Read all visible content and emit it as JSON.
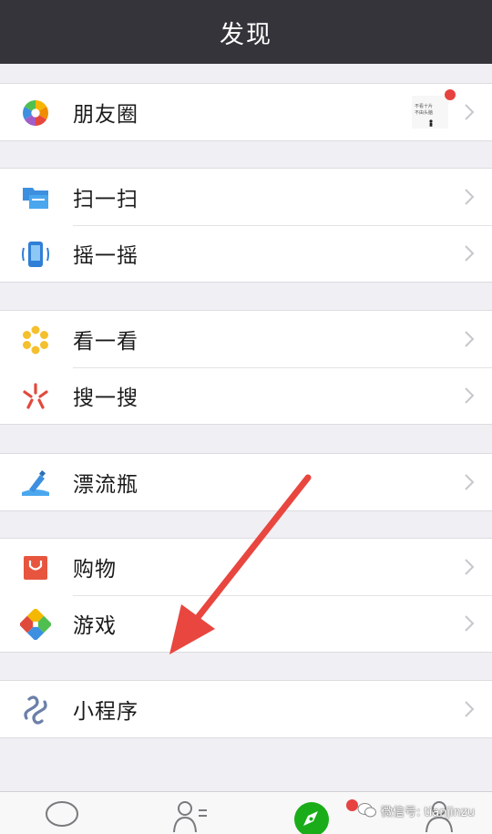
{
  "navbar": {
    "title": "发现"
  },
  "groups": [
    [
      {
        "label": "朋友圈",
        "icon": "moments-icon"
      }
    ],
    [
      {
        "label": "扫一扫",
        "icon": "scan-icon"
      },
      {
        "label": "摇一摇",
        "icon": "shake-icon"
      }
    ],
    [
      {
        "label": "看一看",
        "icon": "top-stories-icon"
      },
      {
        "label": "搜一搜",
        "icon": "search-icon"
      }
    ],
    [
      {
        "label": "漂流瓶",
        "icon": "drift-bottle-icon"
      }
    ],
    [
      {
        "label": "购物",
        "icon": "shopping-icon"
      },
      {
        "label": "游戏",
        "icon": "games-icon"
      }
    ],
    [
      {
        "label": "小程序",
        "icon": "mini-programs-icon"
      }
    ]
  ],
  "moments_thumbnail": {
    "line1": "不看十片",
    "line2": "不由头脑"
  },
  "tabbar": {
    "tabs": [
      "chats-tab",
      "contacts-tab",
      "discover-tab",
      "me-tab"
    ]
  },
  "watermark": {
    "text": "微信号: tianjinzu"
  },
  "colors": {
    "navbar": "#34343a",
    "background": "#efeff4",
    "badge": "#e64340",
    "arrow": "#e8463f",
    "discover_green": "#1aad19"
  }
}
